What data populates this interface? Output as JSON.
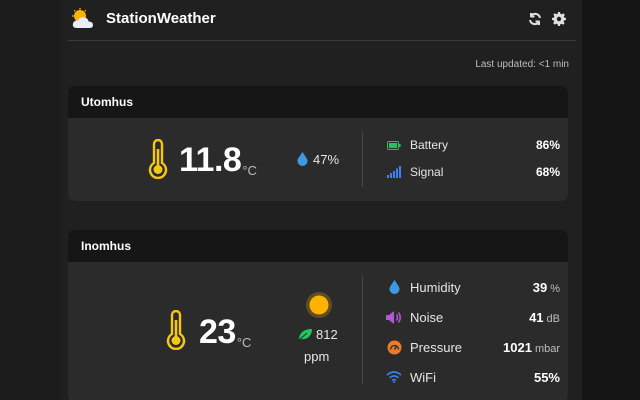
{
  "app": {
    "title": "StationWeather",
    "last_updated": "Last updated: <1 min"
  },
  "outdoor": {
    "name": "Utomhus",
    "temperature": "11.8",
    "temp_unit": "°C",
    "humidity": "47%",
    "stats": [
      {
        "icon": "battery-icon",
        "label": "Battery",
        "value": "86%",
        "unit": "",
        "color": "#21c55d"
      },
      {
        "icon": "signal-icon",
        "label": "Signal",
        "value": "68%",
        "unit": "",
        "color": "#3b82f6"
      }
    ]
  },
  "indoor": {
    "name": "Inomhus",
    "temperature": "23",
    "temp_unit": "°C",
    "co2_value": "812",
    "co2_unit": "ppm",
    "stats": [
      {
        "icon": "droplet-icon",
        "label": "Humidity",
        "value": "39",
        "unit": "%",
        "color": "#3b9ae8"
      },
      {
        "icon": "speaker-icon",
        "label": "Noise",
        "value": "41",
        "unit": "dB",
        "color": "#b05ad6"
      },
      {
        "icon": "gauge-icon",
        "label": "Pressure",
        "value": "1021",
        "unit": "mbar",
        "color": "#ea7b2a"
      },
      {
        "icon": "wifi-icon",
        "label": "WiFi",
        "value": "55%",
        "unit": "",
        "color": "#3b82f6"
      }
    ]
  },
  "colors": {
    "thermometer": "#f5c518",
    "sun": "#ffb300",
    "leaf": "#22c55e"
  }
}
